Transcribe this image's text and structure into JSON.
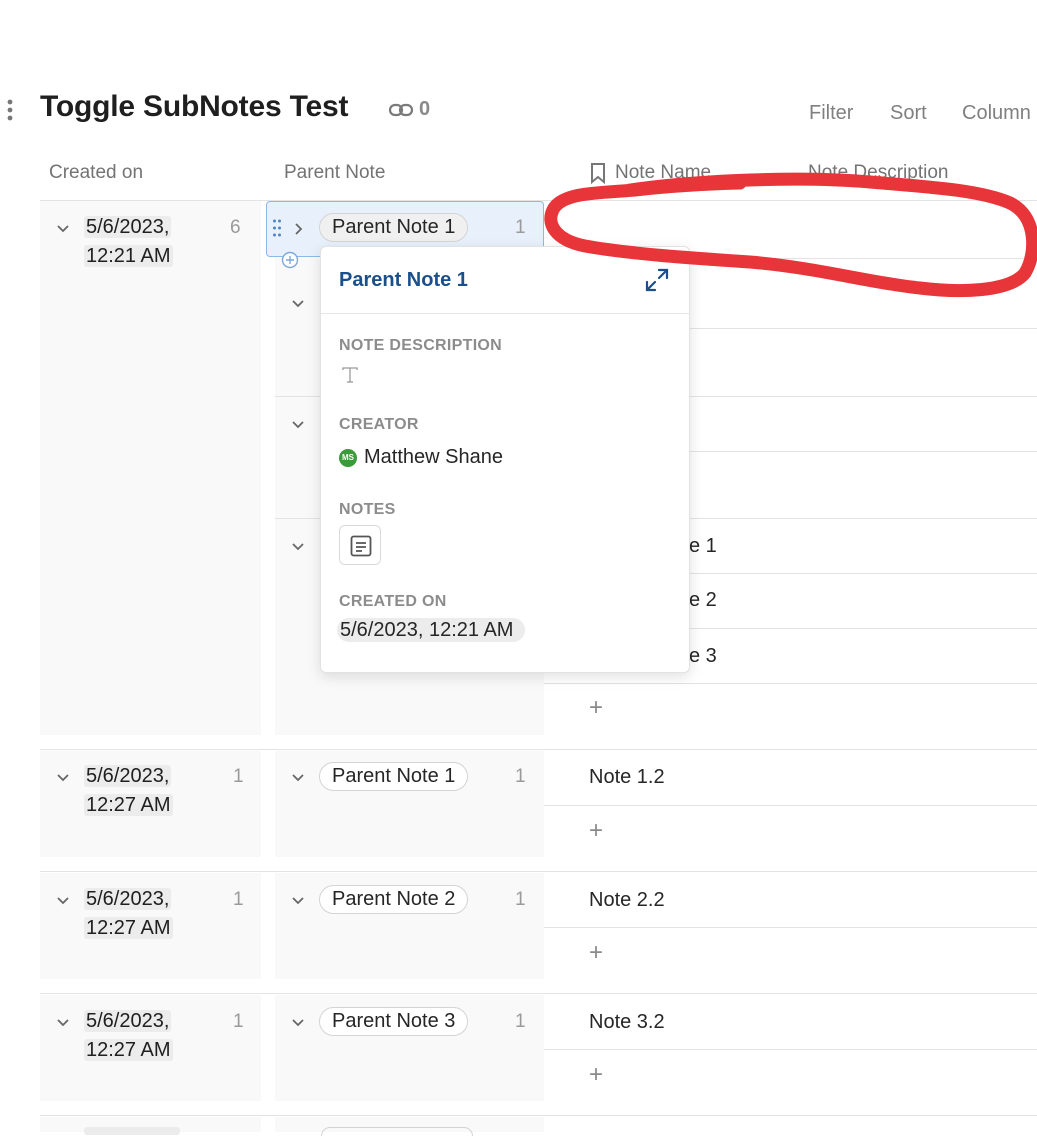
{
  "header": {
    "title": "Toggle SubNotes Test",
    "link_count": "0",
    "filter_label": "Filter",
    "sort_label": "Sort",
    "columns_label": "Column"
  },
  "columns": {
    "created_on": "Created on",
    "parent_note": "Parent Note",
    "note_name": "Note Name",
    "note_description": "Note Description"
  },
  "groups": [
    {
      "date_line1": "5/6/2023,",
      "date_line2": "12:21 AM",
      "count": "6",
      "parent": "Parent Note 1",
      "parent_count": "1",
      "notes_visible": [
        "e 1",
        "e 2",
        "e 3"
      ]
    },
    {
      "date_line1": "5/6/2023,",
      "date_line2": "12:27 AM",
      "count": "1",
      "parent": "Parent Note 1",
      "parent_count": "1",
      "note": "Note 1.2"
    },
    {
      "date_line1": "5/6/2023,",
      "date_line2": "12:27 AM",
      "count": "1",
      "parent": "Parent Note 2",
      "parent_count": "1",
      "note": "Note 2.2"
    },
    {
      "date_line1": "5/6/2023,",
      "date_line2": "12:27 AM",
      "count": "1",
      "parent": "Parent Note 3",
      "parent_count": "1",
      "note": "Note 3.2"
    }
  ],
  "popup": {
    "title": "Parent Note 1",
    "desc_label": "NOTE DESCRIPTION",
    "creator_label": "CREATOR",
    "creator_initials": "MS",
    "creator_name": "Matthew Shane",
    "notes_label": "NOTES",
    "created_label": "CREATED ON",
    "created_value": "5/6/2023, 12:21 AM"
  },
  "add_symbol": "+",
  "colors": {
    "popup_title": "#1b4f8a",
    "annotation": "#e8353a",
    "avatar": "#3a9b3a",
    "selection": "#e8f1fb"
  }
}
